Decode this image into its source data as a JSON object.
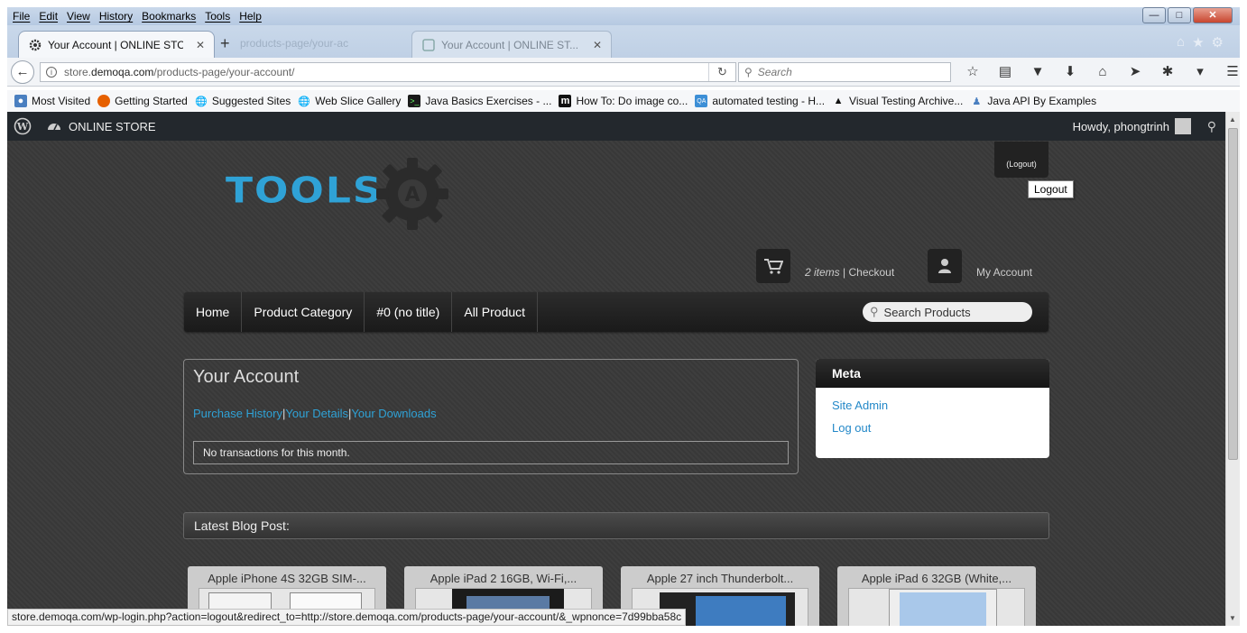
{
  "menu": [
    "File",
    "Edit",
    "View",
    "History",
    "Bookmarks",
    "Tools",
    "Help"
  ],
  "tabs": {
    "active_title": "Your Account | ONLINE STO",
    "ghost_url": "products-page/your-ac",
    "inactive_title": "Your Account | ONLINE ST..."
  },
  "url": {
    "prefix": "store.",
    "host": "demoqa.com",
    "path": "/products-page/your-account/"
  },
  "search": {
    "placeholder": "Search"
  },
  "bookmarks": [
    "Most Visited",
    "Getting Started",
    "Suggested Sites",
    "Web Slice Gallery",
    "Java Basics Exercises - ...",
    "How To: Do image co...",
    "automated testing - H...",
    "Visual Testing Archive...",
    "Java API By Examples"
  ],
  "adminbar": {
    "store": "ONLINE STORE",
    "howdy": "Howdy, phongtrinh"
  },
  "logout": {
    "tab_label": "(Logout)",
    "tooltip": "Logout"
  },
  "logo": {
    "word": "TOOLS",
    "letter": "A"
  },
  "cart": {
    "items": "2 items",
    "separator": " | ",
    "checkout": "Checkout"
  },
  "account_link": "My Account",
  "nav": {
    "items": [
      "Home",
      "Product Category",
      "#0 (no title)",
      "All Product"
    ],
    "search_placeholder": "Search Products"
  },
  "account": {
    "title": "Your Account",
    "links": [
      "Purchase History",
      "Your Details",
      "Your Downloads"
    ],
    "sep": "|",
    "transactions": "No transactions for this month."
  },
  "meta": {
    "title": "Meta",
    "links": [
      "Site Admin",
      "Log out"
    ]
  },
  "blog": {
    "title": "Latest Blog Post:"
  },
  "products": [
    "Apple iPhone 4S 32GB SIM-...",
    "Apple iPad 2 16GB, Wi-Fi,...",
    "Apple 27 inch Thunderbolt...",
    "Apple iPad 6 32GB (White,..."
  ],
  "status": "store.demoqa.com/wp-login.php?action=logout&redirect_to=http://store.demoqa.com/products-page/your-account/&_wpnonce=7d99bba58c",
  "colors": {
    "accent": "#2fa2d6",
    "adminbar": "#23282d",
    "page_bg": "#3a3a3a"
  }
}
